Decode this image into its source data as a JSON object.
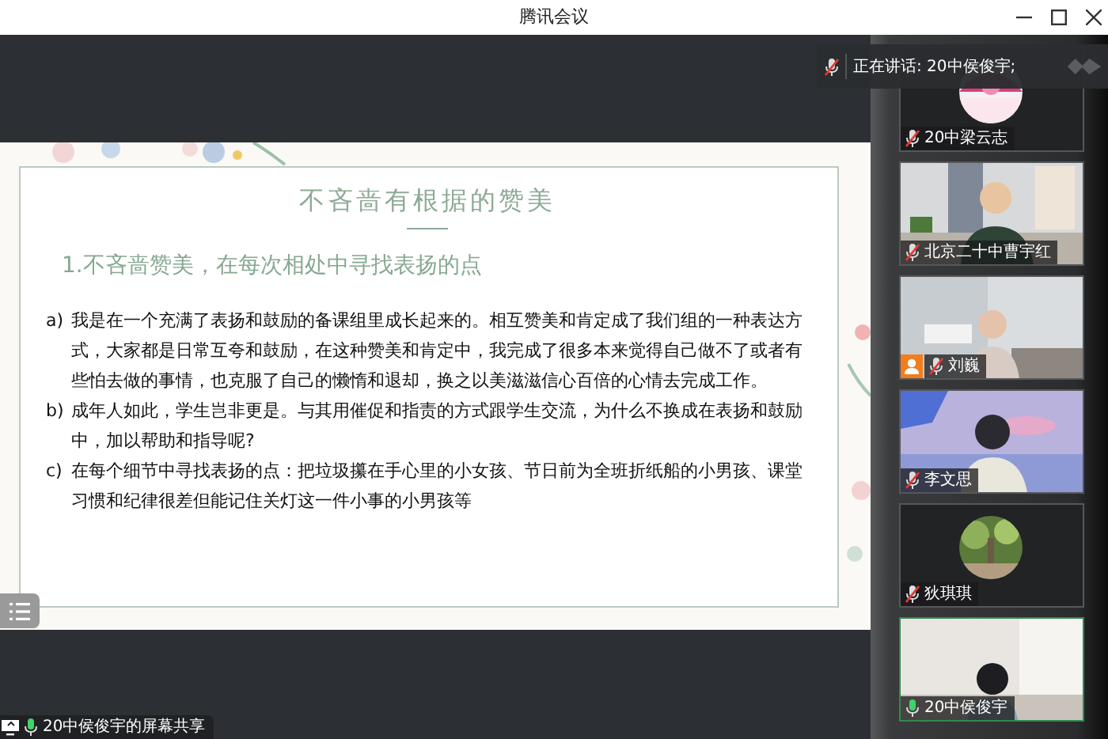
{
  "window": {
    "title": "腾讯会议"
  },
  "slide": {
    "title": "不吝啬有根据的赞美",
    "heading": "1.不吝啬赞美，在每次相处中寻找表扬的点",
    "items": [
      {
        "marker": "a)",
        "text": "我是在一个充满了表扬和鼓励的备课组里成长起来的。相互赞美和肯定成了我们组的一种表达方式，大家都是日常互夸和鼓励，在这种赞美和肯定中，我完成了很多本来觉得自己做不了或者有些怕去做的事情，也克服了自己的懒惰和退却，换之以美滋滋信心百倍的心情去完成工作。"
      },
      {
        "marker": "b)",
        "text": "成年人如此，学生岂非更是。与其用催促和指责的方式跟学生交流，为什么不换成在表扬和鼓励中，加以帮助和指导呢?"
      },
      {
        "marker": "c)",
        "text": "在每个细节中寻找表扬的点：把垃圾攥在手心里的小女孩、节日前为全班折纸船的小男孩、课堂习惯和纪律很差但能记住关灯这一件小事的小男孩等"
      }
    ]
  },
  "speaking_banner": {
    "text": "正在讲话: 20中侯俊宇;",
    "muted": true
  },
  "participants": [
    {
      "name": "20中梁云志",
      "kind": "avatar",
      "muted": true,
      "active": false,
      "host": false
    },
    {
      "name": "北京二十中曹宇红",
      "kind": "video",
      "muted": true,
      "active": false,
      "host": false
    },
    {
      "name": "刘巍",
      "kind": "video",
      "muted": true,
      "active": false,
      "host": true
    },
    {
      "name": "李文思",
      "kind": "video",
      "muted": true,
      "active": false,
      "host": false
    },
    {
      "name": "狄琪琪",
      "kind": "avatar",
      "muted": true,
      "active": false,
      "host": false
    },
    {
      "name": "20中侯俊宇",
      "kind": "video",
      "muted": false,
      "active": true,
      "host": false
    }
  ],
  "share_label": {
    "text": "20中侯俊宇的屏幕共享",
    "muted": false
  }
}
